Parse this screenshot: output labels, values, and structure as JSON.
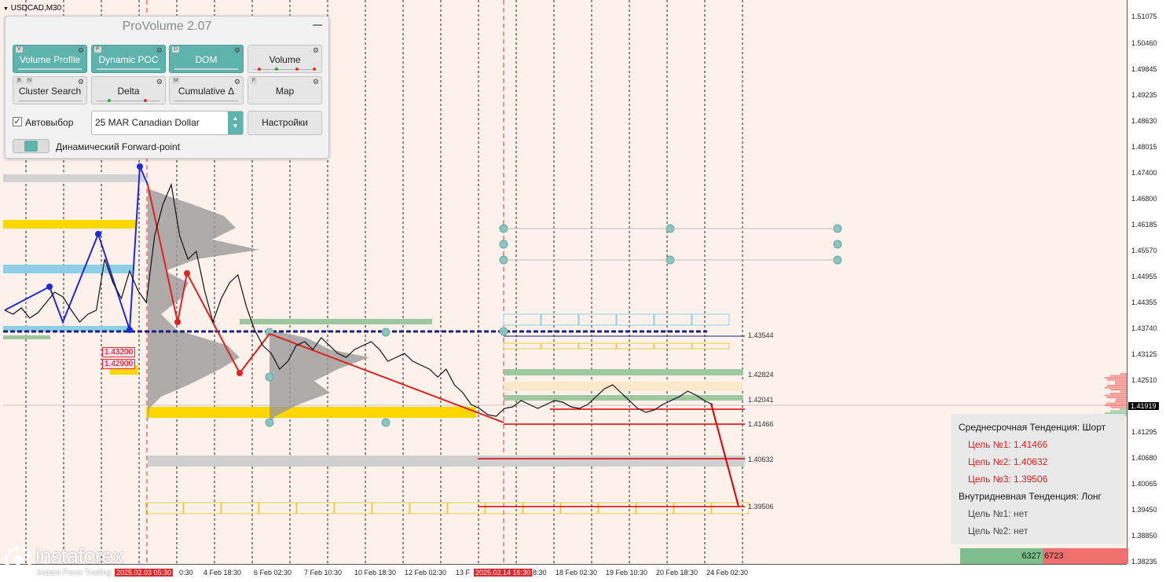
{
  "symbol": "USDCAD,M30",
  "panel": {
    "title": "ProVolume 2.07",
    "buttons": [
      {
        "label": "Volume Profile",
        "key": "V",
        "state": "on"
      },
      {
        "label": "Dynamic POC",
        "key": "P",
        "state": "on"
      },
      {
        "label": "DOM",
        "key": "D",
        "state": "on"
      },
      {
        "label": "Volume",
        "key": "",
        "state": "off"
      },
      {
        "label": "Cluster Search",
        "key": "B",
        "key2": "N",
        "state": "off"
      },
      {
        "label": "Delta",
        "key": "",
        "state": "off"
      },
      {
        "label": "Cumulative Δ",
        "key": "M",
        "state": "off"
      },
      {
        "label": "Map",
        "key": "F",
        "state": "off"
      }
    ],
    "autoselect_label": "Автовыбор",
    "autoselect_checked": true,
    "instrument": "25 MAR Canadian Dollar",
    "settings_label": "Настройки",
    "forward_point_label": "Динамический Forward-point"
  },
  "price_axis": {
    "ticks": [
      "1.51075",
      "1.50460",
      "1.49845",
      "1.49235",
      "1.48630",
      "1.48015",
      "1.47400",
      "1.46800",
      "1.46185",
      "1.45570",
      "1.44955",
      "1.44355",
      "1.43740",
      "1.43125",
      "1.42510",
      "1.41295",
      "1.40680",
      "1.40065",
      "1.39450",
      "1.38850",
      "1.38235"
    ],
    "current_price": "1.41919"
  },
  "time_axis": {
    "labels": [
      {
        "text": "2025.02.03 05:30",
        "highlight": true
      },
      {
        "text": "0:30",
        "highlight": false
      },
      {
        "text": "4 Feb 18:30",
        "highlight": false
      },
      {
        "text": "6 Feb 02:30",
        "highlight": false
      },
      {
        "text": "7 Feb 10:30",
        "highlight": false
      },
      {
        "text": "10 Feb 18:30",
        "highlight": false
      },
      {
        "text": "12 Feb 02:30",
        "highlight": false
      },
      {
        "text": "13 F",
        "highlight": false
      },
      {
        "text": "2025.02.14 16:30",
        "highlight": true
      },
      {
        "text": "8:30",
        "highlight": false
      },
      {
        "text": "18 Feb 02:30",
        "highlight": false
      },
      {
        "text": "19 Feb 10:30",
        "highlight": false
      },
      {
        "text": "20 Feb 18:30",
        "highlight": false
      },
      {
        "text": "24 Feb 02:30",
        "highlight": false
      }
    ]
  },
  "levels": [
    "1.43544",
    "1.42824",
    "1.42041",
    "1.41466",
    "1.40632",
    "1.39506"
  ],
  "box_labels": [
    "1.43200",
    "1.42900"
  ],
  "trend": {
    "mid_header": "Среднесрочная Тенденция: Шорт",
    "mid_targets": [
      "Цель №1: 1.41466",
      "Цель №2: 1.40632",
      "Цель №3: 1.39506"
    ],
    "intra_header": "Внутридневная Тенденция: Лонг",
    "intra_targets": [
      "Цель №1: нет",
      "Цель №2: нет"
    ]
  },
  "volume_bar": {
    "buy": "6327",
    "sell": "6723"
  },
  "logo": {
    "name": "instaforex",
    "tagline": "Instant Forex Trading"
  },
  "colors": {
    "accent": "#5fb3ad",
    "target_red": "#d81b1b",
    "dom_green": "#7fbf8f",
    "dom_red": "#f07070"
  }
}
